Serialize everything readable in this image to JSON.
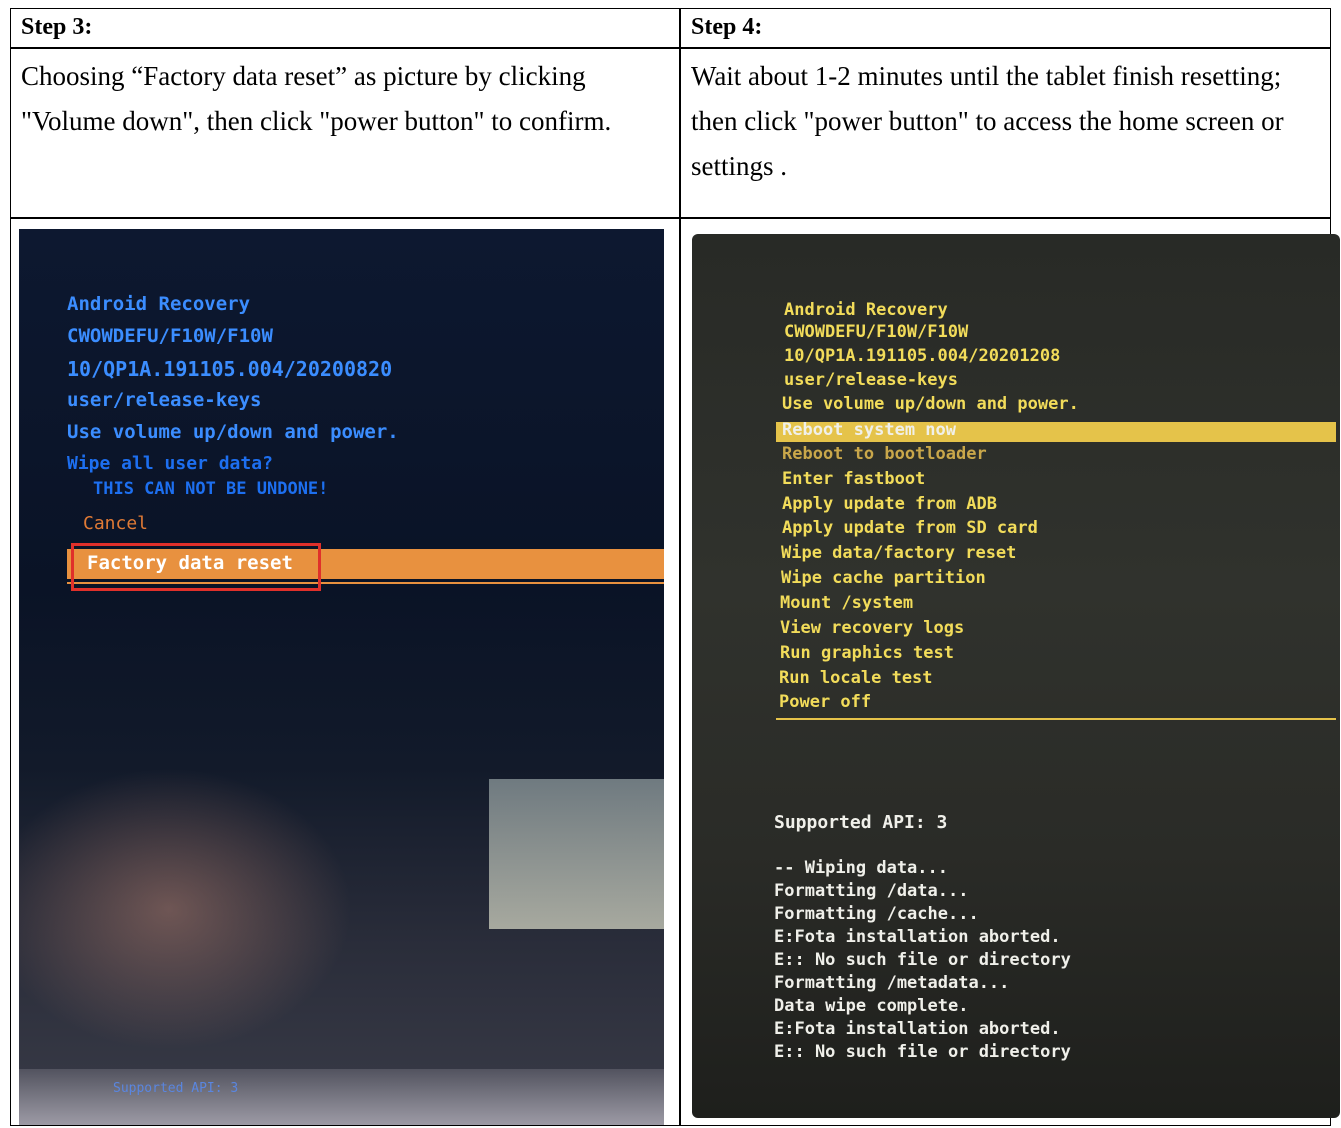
{
  "step3": {
    "header": "Step 3:",
    "text": "Choosing “Factory data reset” as picture by clicking \"Volume down\", then click \"power button\" to confirm.",
    "screen": {
      "lines": [
        "Android Recovery",
        "CWOWDEFU/F10W/F10W",
        "10/QP1A.191105.004/20200820",
        "user/release-keys",
        "Use volume up/down and power."
      ],
      "wipe_prompt": "Wipe all user data?",
      "warning": "THIS CAN NOT BE UNDONE!",
      "cancel": "Cancel",
      "selected": "Factory data reset",
      "api": "Supported API: 3"
    }
  },
  "step4": {
    "header": "Step 4:",
    "text": "Wait about 1-2 minutes until the tablet finish resetting; then click \"power button\" to access the home screen or settings .",
    "screen": {
      "lines": [
        "Android Recovery",
        "CWOWDEFU/F10W/F10W",
        "10/QP1A.191105.004/20201208",
        "user/release-keys",
        "Use volume up/down and power."
      ],
      "selected": "Reboot system now",
      "menu": [
        "Reboot to bootloader",
        "Enter fastboot",
        "Apply update from ADB",
        "Apply update from SD card",
        "Wipe data/factory reset",
        "Wipe cache partition",
        "Mount /system",
        "View recovery logs",
        "Run graphics test",
        "Run locale test",
        "Power off"
      ],
      "api": "Supported API: 3",
      "log": [
        "-- Wiping data...",
        "Formatting /data...",
        "Formatting /cache...",
        "E:Fota installation aborted.",
        "E:: No such file or directory",
        "Formatting /metadata...",
        "Data wipe complete.",
        "E:Fota installation aborted.",
        "E:: No such file or directory"
      ]
    }
  },
  "colors": {
    "selection_orange": "#e8913f",
    "highlight_red": "#e0302a",
    "selection_yellow": "#e5c34a"
  }
}
